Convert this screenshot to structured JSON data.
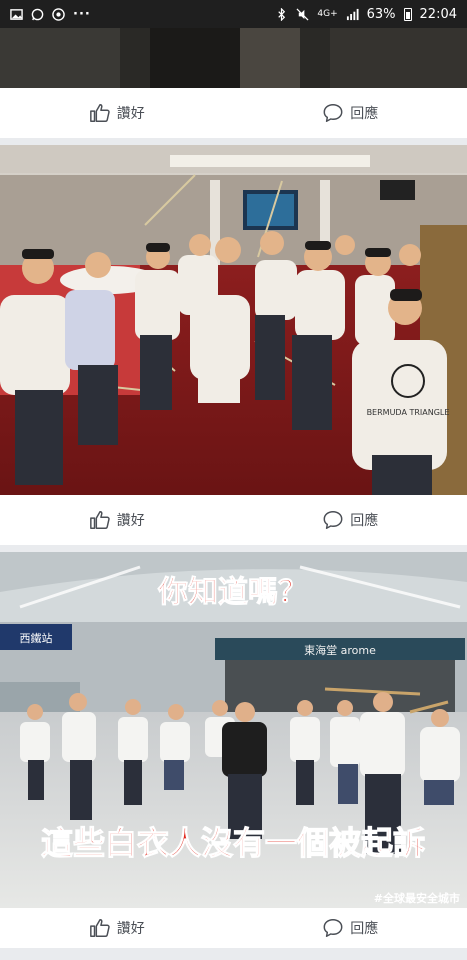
{
  "status_bar": {
    "network": "4G+",
    "battery": "63%",
    "time": "22:04"
  },
  "posts": [
    {
      "like_label": "讚好",
      "comment_label": "回應"
    },
    {
      "like_label": "讚好",
      "comment_label": "回應"
    },
    {
      "like_label": "讚好",
      "comment_label": "回應"
    }
  ],
  "photo2": {
    "shirt_print": "BERMUDA TRIANGLE"
  },
  "photo3": {
    "headline": "你知道嗎？",
    "caption": "這些白衣人沒有一個被起訴",
    "station_sign": "西鐵站",
    "shop_sign": "東海堂 arome",
    "watermark": "#全球最安全城市"
  },
  "colors": {
    "headline_red": "#e0261b",
    "caption_red": "#e0261b",
    "status_bar_bg": "#1f1f1f",
    "action_text": "#4b4f56"
  }
}
